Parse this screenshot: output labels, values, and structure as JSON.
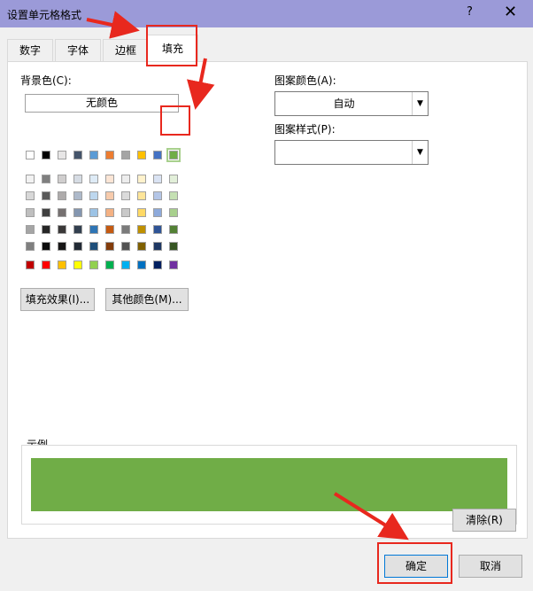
{
  "window": {
    "title": "设置单元格格式",
    "help": "?",
    "close": "✕"
  },
  "tabs": [
    "数字",
    "字体",
    "边框",
    "填充"
  ],
  "background_color": {
    "label": "背景色(C):",
    "no_color_button": "无颜色",
    "fill_effects_button": "填充效果(I)...",
    "more_colors_button": "其他颜色(M)..."
  },
  "pattern": {
    "color_label": "图案颜色(A):",
    "color_value": "自动",
    "style_label": "图案样式(P):",
    "style_value": ""
  },
  "sample": {
    "label": "示例",
    "color": "#70ad47"
  },
  "buttons": {
    "clear": "清除(R)",
    "ok": "确定",
    "cancel": "取消"
  },
  "palette": {
    "top_row": [
      "#ffffff",
      "#000000",
      "#e7e6e6",
      "#44546a",
      "#5b9bd5",
      "#ed7d31",
      "#a5a5a5",
      "#ffc000",
      "#4472c4",
      "#70ad47"
    ],
    "shades": [
      [
        "#f2f2f2",
        "#7f7f7f",
        "#d0cece",
        "#d6dce4",
        "#deebf6",
        "#fbe5d5",
        "#ededed",
        "#fff2cc",
        "#dae3f3",
        "#e2efd9"
      ],
      [
        "#d8d8d8",
        "#595959",
        "#aeabab",
        "#adb9ca",
        "#bdd7ee",
        "#f7cbac",
        "#dbdbdb",
        "#fee599",
        "#b4c6e7",
        "#c5e0b3"
      ],
      [
        "#bfbfbf",
        "#3f3f3f",
        "#757070",
        "#8496b0",
        "#9cc3e5",
        "#f4b183",
        "#c9c9c9",
        "#ffd965",
        "#8eaadb",
        "#a8d08d"
      ],
      [
        "#a5a5a5",
        "#262626",
        "#3a3838",
        "#323f4f",
        "#2e75b5",
        "#c55a11",
        "#7b7b7b",
        "#bf9000",
        "#2f5496",
        "#538135"
      ],
      [
        "#7f7f7f",
        "#0c0c0c",
        "#171616",
        "#222a35",
        "#1e4e79",
        "#833c0b",
        "#525252",
        "#7f6000",
        "#1f3864",
        "#375623"
      ]
    ],
    "standard": [
      "#c00000",
      "#ff0000",
      "#ffc000",
      "#ffff00",
      "#92d050",
      "#00b050",
      "#00b0f0",
      "#0070c0",
      "#002060",
      "#7030a0"
    ]
  }
}
